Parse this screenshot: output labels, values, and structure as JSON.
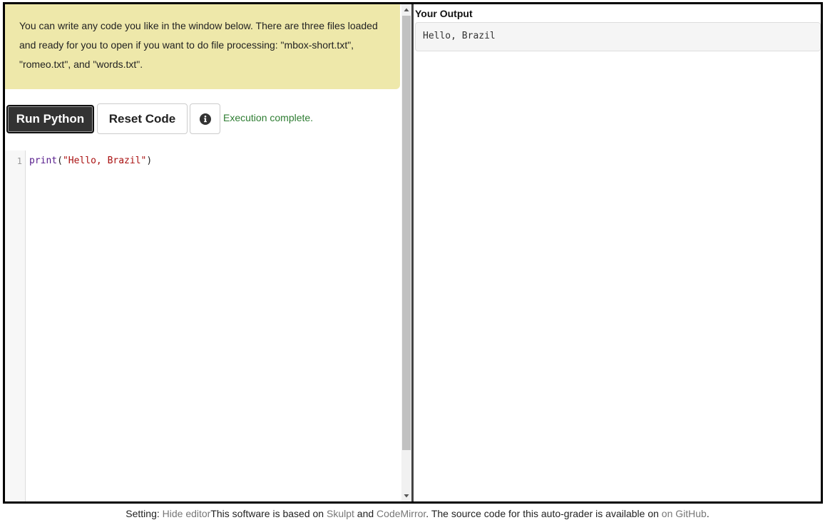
{
  "instructions": {
    "text": "You can write any code you like in the window below. There are three files loaded and ready for you to open if you want to do file processing: \"mbox-short.txt\", \"romeo.txt\", and \"words.txt\"."
  },
  "toolbar": {
    "run_label": "Run Python",
    "reset_label": "Reset Code",
    "info_icon": "info-circle-icon",
    "status": "Execution complete."
  },
  "editor": {
    "line_numbers": [
      "1"
    ],
    "code": {
      "fn": "print",
      "open": "(",
      "str": "\"Hello, Brazil\"",
      "close": ")"
    }
  },
  "output": {
    "title": "Your Output",
    "text": "Hello, Brazil"
  },
  "footer": {
    "setting_label": "Setting: ",
    "hide_editor": "Hide editor",
    "based_on": "This software is based on ",
    "skulpt": "Skulpt",
    "and": " and ",
    "codemirror": "CodeMirror",
    "source_text": ". The source code for this auto-grader is available on ",
    "github": "on GitHub",
    "period": "."
  },
  "colors": {
    "instructions_bg": "#eee8aa",
    "run_button_bg": "#333333",
    "status_green": "#2e7d32"
  }
}
